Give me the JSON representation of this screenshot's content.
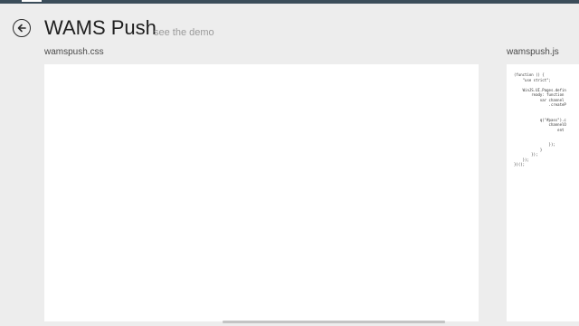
{
  "header": {
    "title": "WAMS Push",
    "subtitle": "see the demo"
  },
  "panels": {
    "css": {
      "label": "wamspush.css"
    },
    "js": {
      "label": "wamspush.js",
      "code_lines": [
        "(function () {",
        "    \"use strict\";",
        "",
        "    WinJS.UI.Pages.defin",
        "        ready: function",
        "            var channel",
        "                .createP",
        "",
        "",
        "            q(\"#pass\").c",
        "                channelO",
        "                    ent",
        "",
        "",
        "                });",
        "            }",
        "        });",
        "    });",
        "})();"
      ]
    }
  }
}
